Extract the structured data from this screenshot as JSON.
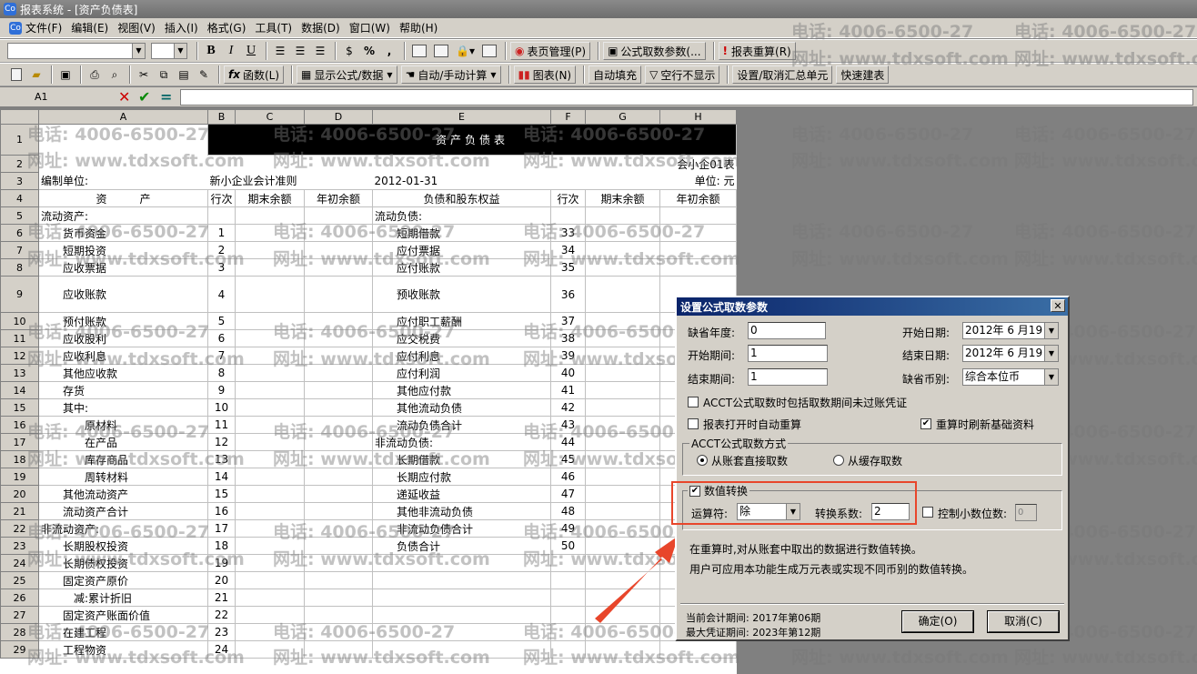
{
  "window": {
    "title": "报表系统 - [资产负债表]",
    "app_icon": "Co"
  },
  "menu": [
    "文件(F)",
    "编辑(E)",
    "视图(V)",
    "插入(I)",
    "格式(G)",
    "工具(T)",
    "数据(D)",
    "窗口(W)",
    "帮助(H)"
  ],
  "toolbar1": {
    "bold": "B",
    "italic": "I",
    "underline": "U",
    "percent": "%",
    "comma": ",",
    "page_mgmt": "表页管理(P)",
    "formula_params": "公式取数参数(...",
    "recalc": "报表重算(R)"
  },
  "toolbar2": {
    "fx": "fx",
    "function": "函数(L)",
    "show_formula": "显示公式/数据",
    "auto_manual": "自动/手动计算",
    "chart": "图表(N)",
    "autofill": "自动填充",
    "hide_empty": "空行不显示",
    "summary": "设置/取消汇总单元",
    "quick_build": "快速建表"
  },
  "formula_bar": {
    "cell_ref": "A1",
    "cancel": "✕",
    "ok": "✔",
    "equals": "="
  },
  "sheet": {
    "columns": [
      "",
      "A",
      "B",
      "C",
      "D",
      "E",
      "F",
      "G",
      "H"
    ],
    "title": "资产负债表",
    "form_no": "会小企01表",
    "org_label": "编制单位:",
    "standard": "新小企业会计准则",
    "date": "2012-01-31",
    "unit": "单位: 元",
    "headers": [
      "资　　　产",
      "行次",
      "期末余额",
      "年初余额",
      "负债和股东权益",
      "行次",
      "期末余额",
      "年初余额"
    ],
    "rows": [
      {
        "n": "5",
        "a": "流动资产:",
        "b": "",
        "e": "流动负债:",
        "f": ""
      },
      {
        "n": "6",
        "a": "　　货币资金",
        "b": "1",
        "e": "　　短期借款",
        "f": "33"
      },
      {
        "n": "7",
        "a": "　　短期投资",
        "b": "2",
        "e": "　　应付票据",
        "f": "34"
      },
      {
        "n": "8",
        "a": "　　应收票据",
        "b": "3",
        "e": "　　应付账款",
        "f": "35"
      },
      {
        "n": "9",
        "a": "　　应收账款",
        "b": "4",
        "e": "　　预收账款",
        "f": "36",
        "tall": true
      },
      {
        "n": "10",
        "a": "　　预付账款",
        "b": "5",
        "e": "　　应付职工薪酬",
        "f": "37"
      },
      {
        "n": "11",
        "a": "　　应收股利",
        "b": "6",
        "e": "　　应交税费",
        "f": "38"
      },
      {
        "n": "12",
        "a": "　　应收利息",
        "b": "7",
        "e": "　　应付利息",
        "f": "39"
      },
      {
        "n": "13",
        "a": "　　其他应收款",
        "b": "8",
        "e": "　　应付利润",
        "f": "40"
      },
      {
        "n": "14",
        "a": "　　存货",
        "b": "9",
        "e": "　　其他应付款",
        "f": "41"
      },
      {
        "n": "15",
        "a": "　　其中:",
        "b": "10",
        "e": "　　其他流动负债",
        "f": "42"
      },
      {
        "n": "16",
        "a": "　　　　原材料",
        "b": "11",
        "e": "　　流动负债合计",
        "f": "43"
      },
      {
        "n": "17",
        "a": "　　　　在产品",
        "b": "12",
        "e": "非流动负债:",
        "f": "44"
      },
      {
        "n": "18",
        "a": "　　　　库存商品",
        "b": "13",
        "e": "　　长期借款",
        "f": "45"
      },
      {
        "n": "19",
        "a": "　　　　周转材料",
        "b": "14",
        "e": "　　长期应付款",
        "f": "46"
      },
      {
        "n": "20",
        "a": "　　其他流动资产",
        "b": "15",
        "e": "　　递延收益",
        "f": "47"
      },
      {
        "n": "21",
        "a": "　　流动资产合计",
        "b": "16",
        "e": "　　其他非流动负债",
        "f": "48"
      },
      {
        "n": "22",
        "a": "非流动资产:",
        "b": "17",
        "e": "　　非流动负债合计",
        "f": "49"
      },
      {
        "n": "23",
        "a": "　　长期股权投资",
        "b": "18",
        "e": "　　负债合计",
        "f": "50"
      },
      {
        "n": "24",
        "a": "　　长期债权投资",
        "b": "19",
        "e": "",
        "f": ""
      },
      {
        "n": "25",
        "a": "　　固定资产原价",
        "b": "20",
        "e": "",
        "f": ""
      },
      {
        "n": "26",
        "a": "　　　减:累计折旧",
        "b": "21",
        "e": "",
        "f": ""
      },
      {
        "n": "27",
        "a": "　　固定资产账面价值",
        "b": "22",
        "e": "",
        "f": ""
      },
      {
        "n": "28",
        "a": "　　在建工程",
        "b": "23",
        "e": "",
        "f": ""
      },
      {
        "n": "29",
        "a": "　　工程物资",
        "b": "24",
        "e": "",
        "f": ""
      }
    ]
  },
  "watermarks": {
    "phone": "电话: 4006-6500-27",
    "site": "网址: www.tdxsoft.com"
  },
  "dialog": {
    "title": "设置公式取数参数",
    "default_year_label": "缺省年度:",
    "default_year": "0",
    "start_period_label": "开始期间:",
    "start_period": "1",
    "end_period_label": "结束期间:",
    "end_period": "1",
    "start_date_label": "开始日期:",
    "start_date": "2012年 6 月19日",
    "end_date_label": "结束日期:",
    "end_date": "2012年 6 月19日",
    "currency_label": "缺省币别:",
    "currency": "综合本位币",
    "chk_include_unposted": "ACCT公式取数时包括取数期间未过账凭证",
    "chk_auto_recalc": "报表打开时自动重算",
    "chk_refresh": "重算时刷新基础资料",
    "method_group": "ACCT公式取数方式",
    "radio_direct": "从账套直接取数",
    "radio_cache": "从缓存取数",
    "convert_group": "数值转换",
    "operator_label": "运算符:",
    "operator": "除",
    "factor_label": "转换系数:",
    "factor": "2",
    "decimals_label": "控制小数位数:",
    "decimals": "0",
    "desc1": "在重算时,对从账套中取出的数据进行数值转换。",
    "desc2": "用户可应用本功能生成万元表或实现不同币别的数值转换。",
    "current_period": "当前会计期间: 2017年第06期",
    "max_voucher": "最大凭证期间: 2023年第12期",
    "ok": "确定(O)",
    "cancel": "取消(C)"
  }
}
